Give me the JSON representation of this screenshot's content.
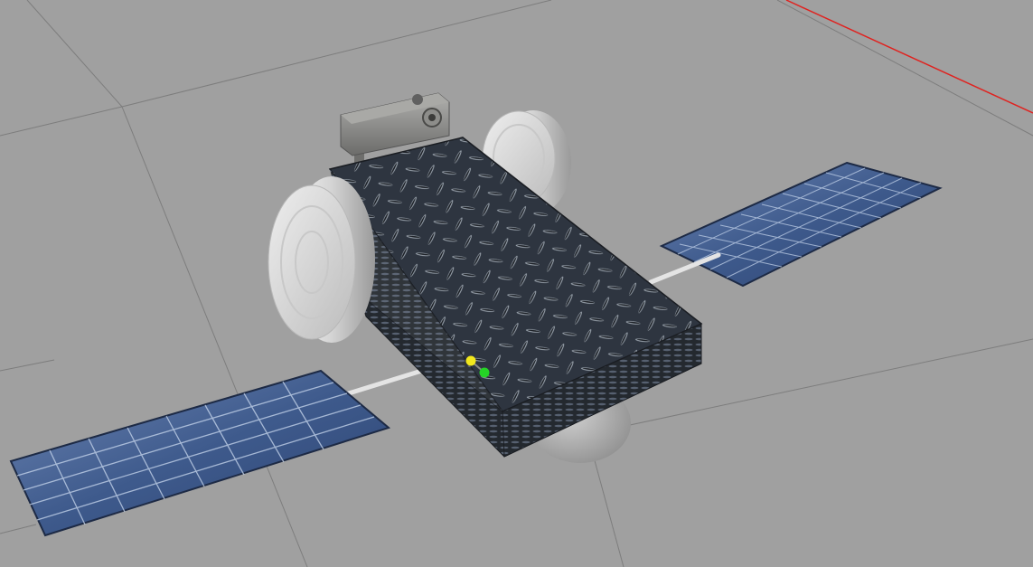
{
  "viewport": {
    "background_color": "#a0a0a0",
    "grid_line_color": "#7d7d7d",
    "x_axis_color": "#e0221f"
  },
  "robot": {
    "chassis_color": "#2b313b",
    "tread_plate_pattern": "diamond-plate",
    "wheel_color": "#d9d9d9",
    "caster_color": "#b5b5b5",
    "camera_color": "#8a8a88",
    "solar_panel_color": "#3b5584",
    "solar_panel_grid_color": "#c9d8ee",
    "panel_rod_color": "#e4e4e4"
  },
  "markers": [
    {
      "name": "marker-yellow",
      "color": "#f2e81d"
    },
    {
      "name": "marker-green",
      "color": "#25d426"
    }
  ]
}
